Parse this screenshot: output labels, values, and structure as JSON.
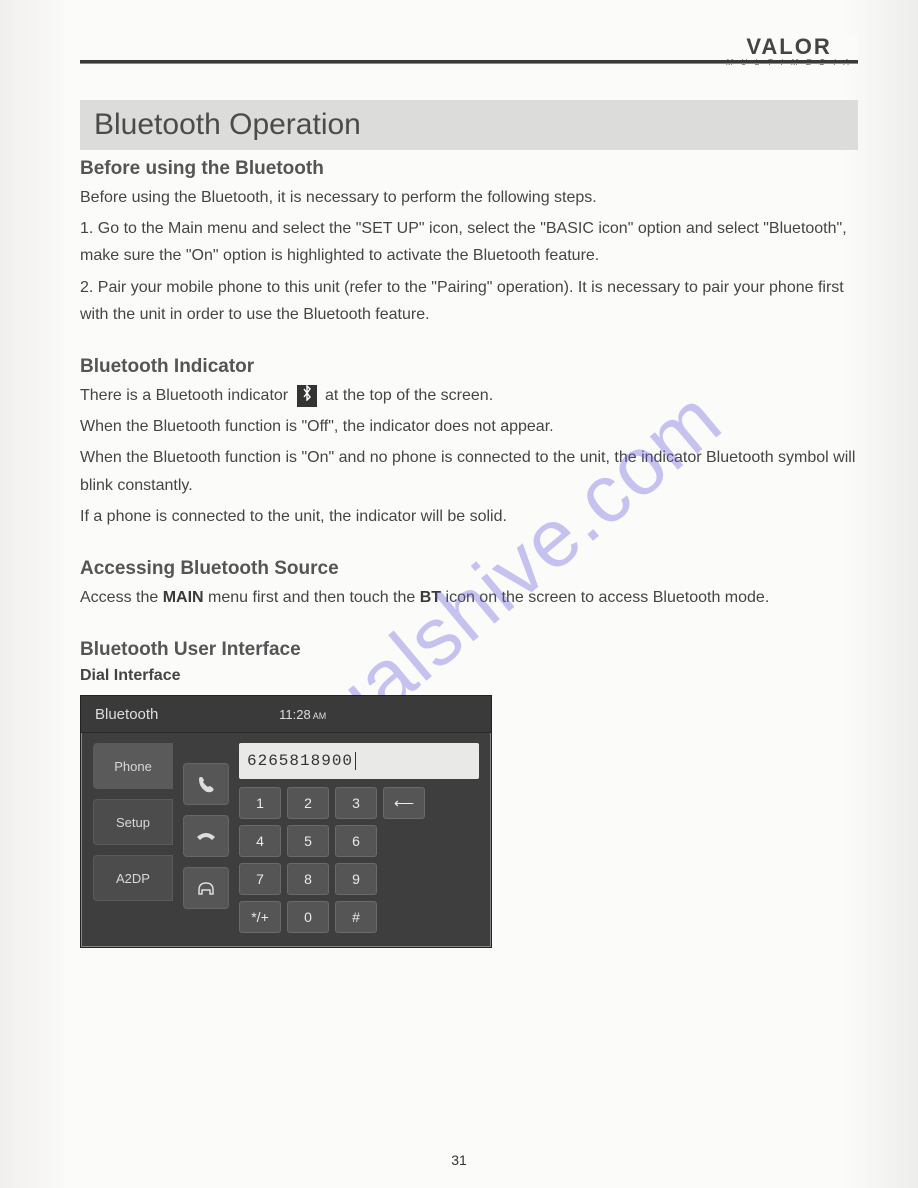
{
  "brand": {
    "main": "VALOR",
    "sub": "M U L T I M E D I A"
  },
  "watermark": "manualshive.com",
  "title": "Bluetooth Operation",
  "section_before": {
    "heading": "Before using the Bluetooth",
    "intro": "Before using the Bluetooth, it is necessary to perform the following steps.",
    "step1": "1. Go to the Main menu and select the \"SET UP\" icon, select the \"BASIC icon\" option and select \"Bluetooth\", make sure the \"On\" option is highlighted to activate the Bluetooth feature.",
    "step2": "2. Pair your mobile phone to this unit (refer to the \"Pairing\" operation). It is necessary to pair your phone first with the unit in order to use the Bluetooth feature."
  },
  "section_indicator": {
    "heading": "Bluetooth Indicator",
    "line1a": "There is a Bluetooth indicator",
    "line1b": "at the top of the screen.",
    "line2": "When the Bluetooth function is \"Off\", the indicator does not appear.",
    "line3": "When the Bluetooth function is \"On\" and no phone is connected to the unit, the indicator Bluetooth symbol will blink constantly.",
    "line4": "If a phone is connected to the unit, the indicator will be solid."
  },
  "section_access": {
    "heading": "Accessing Bluetooth Source",
    "text_a": "Access the ",
    "bold1": "MAIN",
    "text_b": " menu first and then touch the ",
    "bold2": "BT",
    "text_c": " icon on the screen to access Bluetooth mode."
  },
  "section_ui": {
    "heading": "Bluetooth User Interface",
    "sub": "Dial Interface"
  },
  "dial": {
    "title": "Bluetooth",
    "time": "11:28",
    "ampm": "AM",
    "tabs": {
      "phone": "Phone",
      "setup": "Setup",
      "a2dp": "A2DP"
    },
    "mid": {
      "call": "✆",
      "hangup": "⌐",
      "headset": "🎧"
    },
    "number": "6265818900",
    "keys": {
      "k1": "1",
      "k2": "2",
      "k3": "3",
      "back": "⟵",
      "k4": "4",
      "k5": "5",
      "k6": "6",
      "k7": "7",
      "k8": "8",
      "k9": "9",
      "star": "*/+",
      "k0": "0",
      "hash": "#"
    }
  },
  "page_number": "31",
  "icons": {
    "bluetooth_glyph": "✱"
  }
}
